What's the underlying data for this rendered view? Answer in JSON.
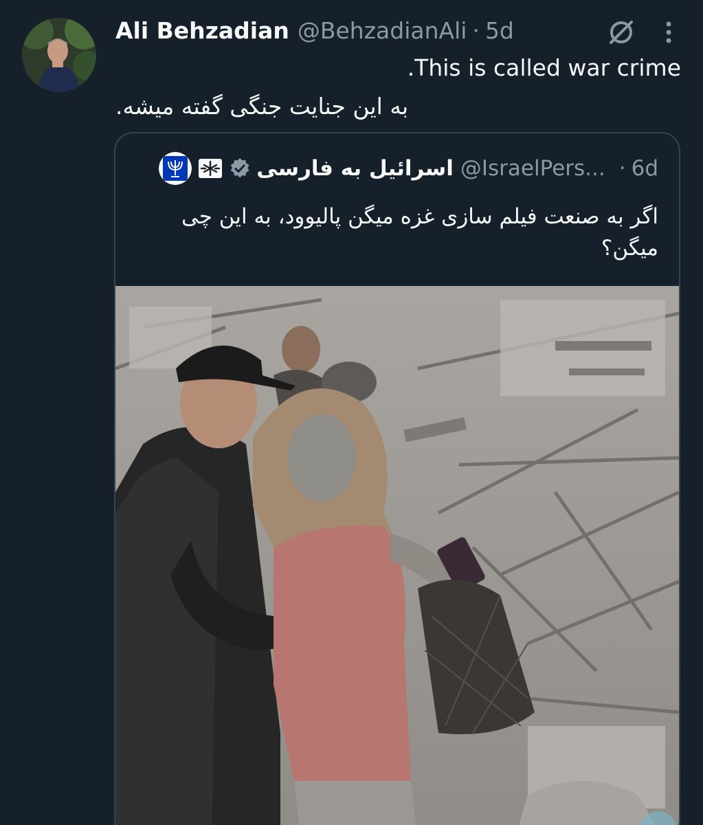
{
  "tweet": {
    "author": {
      "display_name": "Ali Behzadian",
      "handle": "@BehzadianAli",
      "time": "5d"
    },
    "separator": "·",
    "text_en": ".This is called war crime",
    "text_fa": "به این جنایت جنگی گفته میشه."
  },
  "quote": {
    "author": {
      "display_name": "اسرائیل به فارسی",
      "handle": "@IsraelPers...",
      "time": "6d"
    },
    "separator": "·",
    "text": "اگر به صنعت فیلم سازی غزه میگن پالیوود، به این چی میگن؟"
  },
  "colors": {
    "background": "#15202b",
    "text_primary": "#f7f9f9",
    "text_secondary": "#8b98a5",
    "border": "#38444d",
    "verified_badge": "#8b98a5",
    "israel_blue": "#0038b8"
  },
  "icons": {
    "grok": "slashed-circle-icon",
    "more": "vertical-dots-icon",
    "verified": "verified-badge-icon",
    "flag": "snowflake-flag-icon",
    "avatar": "avatar-photo",
    "quote_avatar": "menorah-emblem-icon"
  }
}
